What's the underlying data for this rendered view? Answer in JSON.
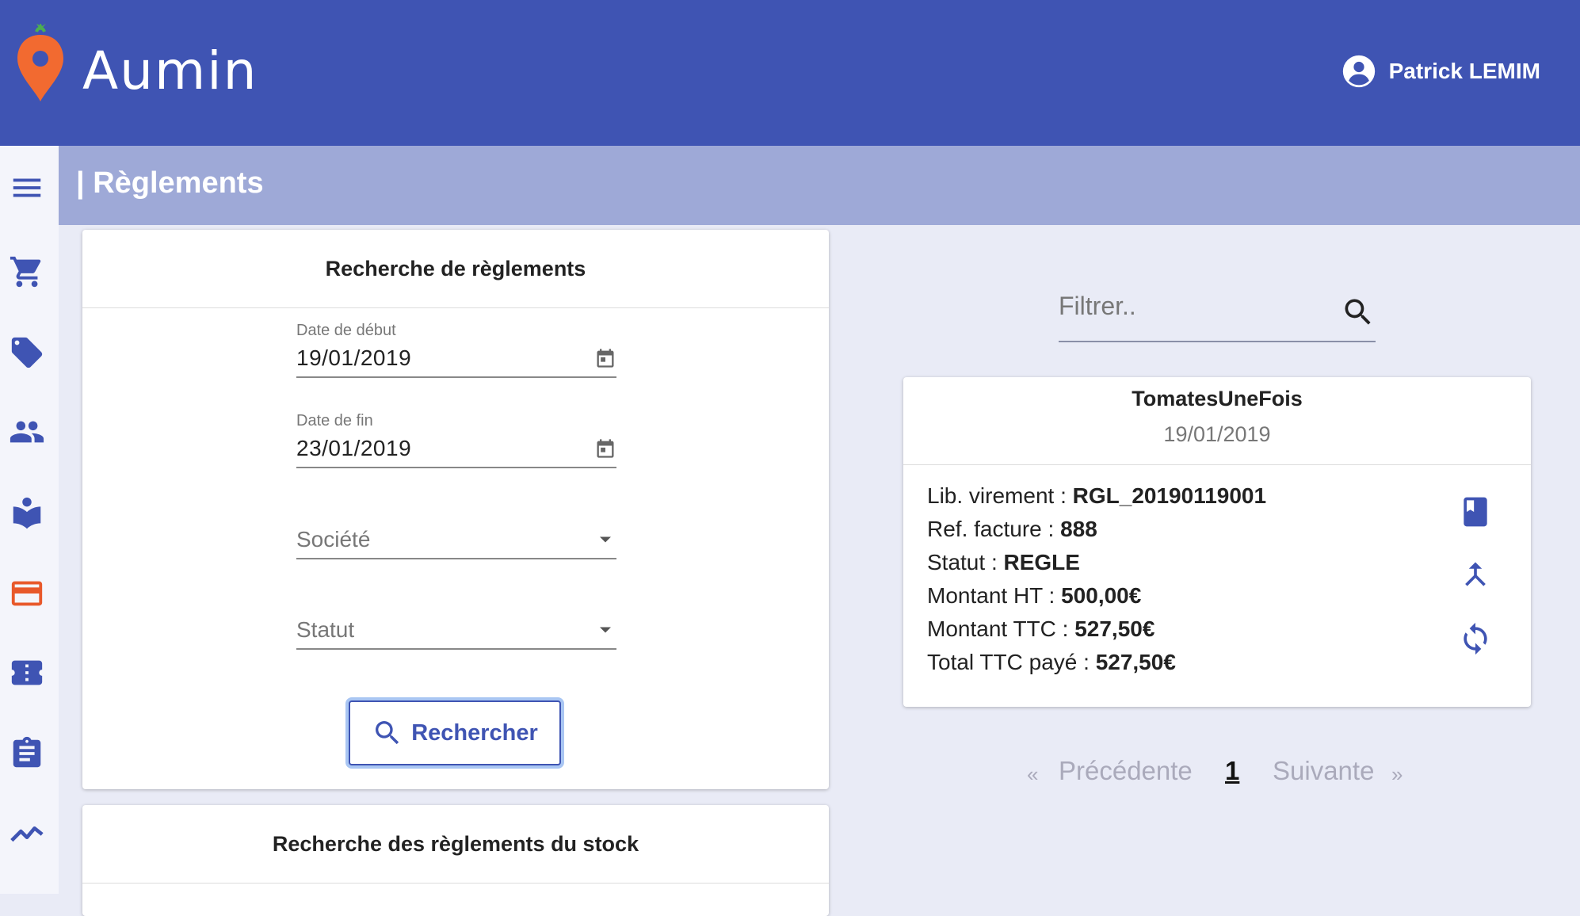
{
  "brand": {
    "name": "Aumin"
  },
  "header": {
    "user_name": "Patrick LEMIM"
  },
  "page": {
    "title": "| Règlements"
  },
  "sidebar": {
    "icons": [
      "menu-icon",
      "cart-icon",
      "tag-icon",
      "users-icon",
      "book-icon",
      "credit-card-icon",
      "ticket-icon",
      "clipboard-icon",
      "chart-line-icon"
    ],
    "active_color": "#e8582a"
  },
  "search_card": {
    "title": "Recherche de règlements",
    "start_date": {
      "label": "Date de début",
      "value": "19/01/2019"
    },
    "end_date": {
      "label": "Date de fin",
      "value": "23/01/2019"
    },
    "societe": {
      "placeholder": "Société"
    },
    "statut": {
      "placeholder": "Statut"
    },
    "button_label": "Rechercher"
  },
  "stock_card": {
    "title": "Recherche des règlements du stock"
  },
  "filter": {
    "placeholder": "Filtrer.."
  },
  "result": {
    "company": "TomatesUneFois",
    "date": "19/01/2019",
    "lines": [
      {
        "label": "Lib. virement : ",
        "value": "RGL_20190119001"
      },
      {
        "label": "Ref. facture : ",
        "value": "888"
      },
      {
        "label": "Statut : ",
        "value": "REGLE"
      },
      {
        "label": "Montant HT : ",
        "value": "500,00€"
      },
      {
        "label": "Montant TTC : ",
        "value": "527,50€"
      },
      {
        "label": "Total TTC payé : ",
        "value": "527,50€"
      }
    ]
  },
  "pagination": {
    "prev_arrow": "«",
    "prev": "Précédente",
    "current": "1",
    "next": "Suivante",
    "next_arrow": "»"
  },
  "colors": {
    "primary": "#3f54b3",
    "header_bg": "#3f54b3",
    "titlebar_bg": "#9ea9d7",
    "page_bg": "#e9ebf6"
  }
}
